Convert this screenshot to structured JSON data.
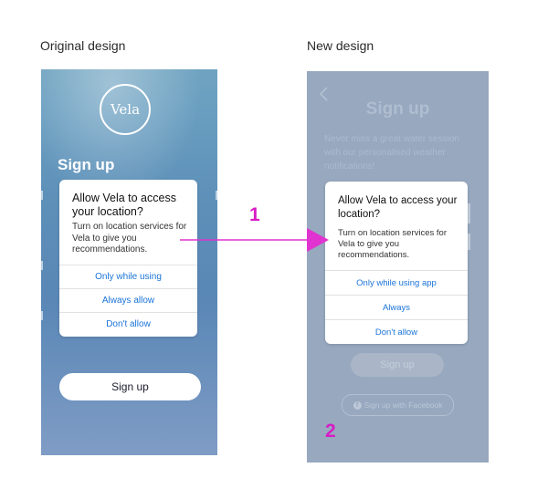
{
  "captions": {
    "original": "Original design",
    "new": "New design"
  },
  "original": {
    "logo_text": "Vela",
    "title": "Sign up",
    "dialog": {
      "title": "Allow Vela to access your location?",
      "body": "Turn on location services for Vela to give you recommendations.",
      "options": [
        "Only while using",
        "Always allow",
        "Don't allow"
      ]
    },
    "signup_button": "Sign up"
  },
  "redesign": {
    "title": "Sign up",
    "subtitle": "Never miss a great water session with our personalised weather notifications!",
    "dialog": {
      "title": "Allow Vela to access your location?",
      "body": "Turn on location services for Vela to give you recommendations.",
      "options": [
        "Only while using app",
        "Always",
        "Don't allow"
      ]
    },
    "signup_button": "Sign up",
    "facebook_button": "Sign up with Facebook"
  },
  "annotations": {
    "one": "1",
    "two": "2"
  },
  "colors": {
    "accent": "#d81cc4",
    "link": "#1a73d9",
    "overlay": "#97a8bf"
  },
  "icons": {
    "back": "chevron-left-icon",
    "facebook": "facebook-icon"
  }
}
